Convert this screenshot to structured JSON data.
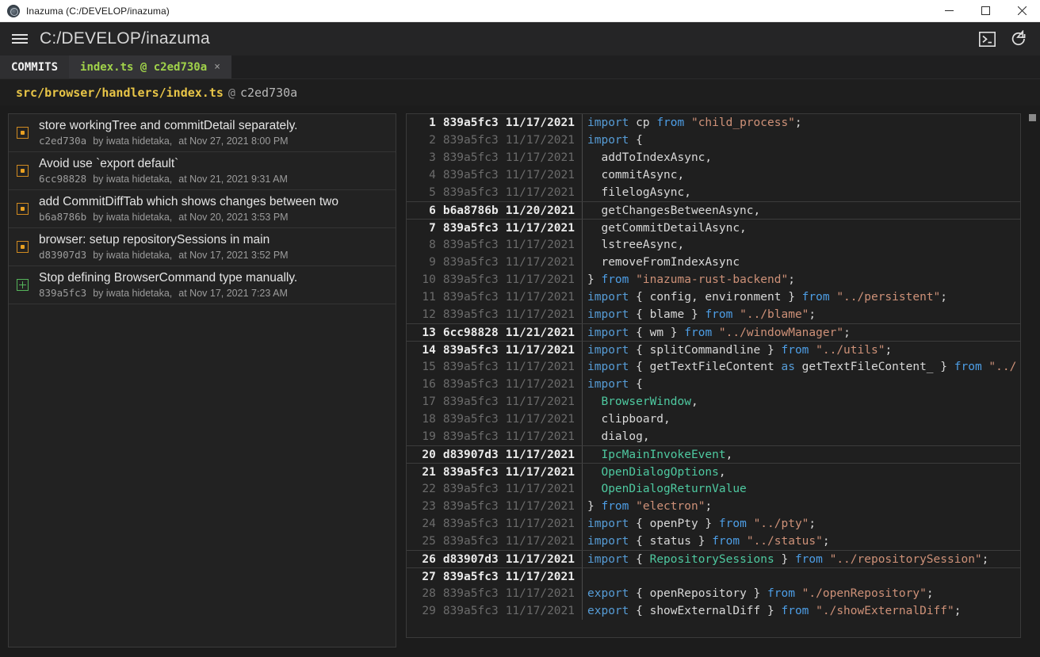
{
  "titlebar": {
    "title": "Inazuma (C:/DEVELOP/inazuma)",
    "app_icon": "app-logo-icon",
    "minimize": "minimize-icon",
    "maximize": "maximize-icon",
    "close": "close-icon"
  },
  "appbar": {
    "menu_icon": "hamburger-menu-icon",
    "repo_path": "C:/DEVELOP/inazuma",
    "terminal_icon": "terminal-icon",
    "refresh_icon": "refresh-icon"
  },
  "tabs": [
    {
      "label": "COMMITS",
      "active": false,
      "closable": false
    },
    {
      "label": "index.ts @ c2ed730a",
      "active": true,
      "closable": true,
      "close_label": "×"
    }
  ],
  "pathline": {
    "file": "src/browser/handlers/index.ts",
    "at": "@",
    "revision": "c2ed730a"
  },
  "commits": [
    {
      "summary": "store workingTree and commitDetail separately.",
      "hash": "c2ed730a",
      "author": "by iwata hidetaka,",
      "date": "at Nov 27, 2021 8:00 PM",
      "mark": "merge"
    },
    {
      "summary": "Avoid use `export default`",
      "hash": "6cc98828",
      "author": "by iwata hidetaka,",
      "date": "at Nov 21, 2021 9:31 AM",
      "mark": "merge"
    },
    {
      "summary": "add CommitDiffTab which shows changes between two",
      "hash": "b6a8786b",
      "author": "by iwata hidetaka,",
      "date": "at Nov 20, 2021 3:53 PM",
      "mark": "merge"
    },
    {
      "summary": "browser: setup repositorySessions in main",
      "hash": "d83907d3",
      "author": "by iwata hidetaka,",
      "date": "at Nov 17, 2021 3:52 PM",
      "mark": "merge"
    },
    {
      "summary": "Stop defining BrowserCommand type manually.",
      "hash": "839a5fc3",
      "author": "by iwata hidetaka,",
      "date": "at Nov 17, 2021 7:23 AM",
      "mark": "plus"
    }
  ],
  "blame_lines": [
    {
      "ln": "1",
      "hash": "839a5fc3",
      "date": "11/17/2021",
      "bright": true,
      "groupstart": true,
      "tokens": [
        {
          "t": "kw",
          "v": "import"
        },
        {
          "t": "punct",
          "v": " cp "
        },
        {
          "t": "from",
          "v": "from"
        },
        {
          "t": "punct",
          "v": " "
        },
        {
          "t": "str",
          "v": "\"child_process\""
        },
        {
          "t": "punct",
          "v": ";"
        }
      ]
    },
    {
      "ln": "2",
      "hash": "839a5fc3",
      "date": "11/17/2021",
      "bright": false,
      "groupstart": false,
      "tokens": [
        {
          "t": "kw",
          "v": "import"
        },
        {
          "t": "punct",
          "v": " {"
        }
      ]
    },
    {
      "ln": "3",
      "hash": "839a5fc3",
      "date": "11/17/2021",
      "bright": false,
      "groupstart": false,
      "tokens": [
        {
          "t": "id",
          "v": "  addToIndexAsync,"
        }
      ]
    },
    {
      "ln": "4",
      "hash": "839a5fc3",
      "date": "11/17/2021",
      "bright": false,
      "groupstart": false,
      "tokens": [
        {
          "t": "id",
          "v": "  commitAsync,"
        }
      ]
    },
    {
      "ln": "5",
      "hash": "839a5fc3",
      "date": "11/17/2021",
      "bright": false,
      "groupstart": false,
      "tokens": [
        {
          "t": "id",
          "v": "  filelogAsync,"
        }
      ]
    },
    {
      "ln": "6",
      "hash": "b6a8786b",
      "date": "11/20/2021",
      "bright": true,
      "groupstart": true,
      "tokens": [
        {
          "t": "id",
          "v": "  getChangesBetweenAsync,"
        }
      ]
    },
    {
      "ln": "7",
      "hash": "839a5fc3",
      "date": "11/17/2021",
      "bright": true,
      "groupstart": true,
      "tokens": [
        {
          "t": "id",
          "v": "  getCommitDetailAsync,"
        }
      ]
    },
    {
      "ln": "8",
      "hash": "839a5fc3",
      "date": "11/17/2021",
      "bright": false,
      "groupstart": false,
      "tokens": [
        {
          "t": "id",
          "v": "  lstreeAsync,"
        }
      ]
    },
    {
      "ln": "9",
      "hash": "839a5fc3",
      "date": "11/17/2021",
      "bright": false,
      "groupstart": false,
      "tokens": [
        {
          "t": "id",
          "v": "  removeFromIndexAsync"
        }
      ]
    },
    {
      "ln": "10",
      "hash": "839a5fc3",
      "date": "11/17/2021",
      "bright": false,
      "groupstart": false,
      "tokens": [
        {
          "t": "punct",
          "v": "} "
        },
        {
          "t": "from",
          "v": "from"
        },
        {
          "t": "punct",
          "v": " "
        },
        {
          "t": "str",
          "v": "\"inazuma-rust-backend\""
        },
        {
          "t": "punct",
          "v": ";"
        }
      ]
    },
    {
      "ln": "11",
      "hash": "839a5fc3",
      "date": "11/17/2021",
      "bright": false,
      "groupstart": false,
      "tokens": [
        {
          "t": "kw",
          "v": "import"
        },
        {
          "t": "punct",
          "v": " { "
        },
        {
          "t": "id",
          "v": "config, environment"
        },
        {
          "t": "punct",
          "v": " } "
        },
        {
          "t": "from",
          "v": "from"
        },
        {
          "t": "punct",
          "v": " "
        },
        {
          "t": "str",
          "v": "\"../persistent\""
        },
        {
          "t": "punct",
          "v": ";"
        }
      ]
    },
    {
      "ln": "12",
      "hash": "839a5fc3",
      "date": "11/17/2021",
      "bright": false,
      "groupstart": false,
      "tokens": [
        {
          "t": "kw",
          "v": "import"
        },
        {
          "t": "punct",
          "v": " { "
        },
        {
          "t": "id",
          "v": "blame"
        },
        {
          "t": "punct",
          "v": " } "
        },
        {
          "t": "from",
          "v": "from"
        },
        {
          "t": "punct",
          "v": " "
        },
        {
          "t": "str",
          "v": "\"../blame\""
        },
        {
          "t": "punct",
          "v": ";"
        }
      ]
    },
    {
      "ln": "13",
      "hash": "6cc98828",
      "date": "11/21/2021",
      "bright": true,
      "groupstart": true,
      "tokens": [
        {
          "t": "kw",
          "v": "import"
        },
        {
          "t": "punct",
          "v": " { "
        },
        {
          "t": "id",
          "v": "wm"
        },
        {
          "t": "punct",
          "v": " } "
        },
        {
          "t": "from",
          "v": "from"
        },
        {
          "t": "punct",
          "v": " "
        },
        {
          "t": "str",
          "v": "\"../windowManager\""
        },
        {
          "t": "punct",
          "v": ";"
        }
      ]
    },
    {
      "ln": "14",
      "hash": "839a5fc3",
      "date": "11/17/2021",
      "bright": true,
      "groupstart": true,
      "tokens": [
        {
          "t": "kw",
          "v": "import"
        },
        {
          "t": "punct",
          "v": " { "
        },
        {
          "t": "id",
          "v": "splitCommandline"
        },
        {
          "t": "punct",
          "v": " } "
        },
        {
          "t": "from",
          "v": "from"
        },
        {
          "t": "punct",
          "v": " "
        },
        {
          "t": "str",
          "v": "\"../utils\""
        },
        {
          "t": "punct",
          "v": ";"
        }
      ]
    },
    {
      "ln": "15",
      "hash": "839a5fc3",
      "date": "11/17/2021",
      "bright": false,
      "groupstart": false,
      "tokens": [
        {
          "t": "kw",
          "v": "import"
        },
        {
          "t": "punct",
          "v": " { "
        },
        {
          "t": "id",
          "v": "getTextFileContent "
        },
        {
          "t": "as",
          "v": "as"
        },
        {
          "t": "id",
          "v": " getTextFileContent_"
        },
        {
          "t": "punct",
          "v": " } "
        },
        {
          "t": "from",
          "v": "from"
        },
        {
          "t": "punct",
          "v": " "
        },
        {
          "t": "str",
          "v": "\"../"
        }
      ]
    },
    {
      "ln": "16",
      "hash": "839a5fc3",
      "date": "11/17/2021",
      "bright": false,
      "groupstart": false,
      "tokens": [
        {
          "t": "kw",
          "v": "import"
        },
        {
          "t": "punct",
          "v": " {"
        }
      ]
    },
    {
      "ln": "17",
      "hash": "839a5fc3",
      "date": "11/17/2021",
      "bright": false,
      "groupstart": false,
      "tokens": [
        {
          "t": "type",
          "v": "  BrowserWindow"
        },
        {
          "t": "punct",
          "v": ","
        }
      ]
    },
    {
      "ln": "18",
      "hash": "839a5fc3",
      "date": "11/17/2021",
      "bright": false,
      "groupstart": false,
      "tokens": [
        {
          "t": "id",
          "v": "  clipboard,"
        }
      ]
    },
    {
      "ln": "19",
      "hash": "839a5fc3",
      "date": "11/17/2021",
      "bright": false,
      "groupstart": false,
      "tokens": [
        {
          "t": "id",
          "v": "  dialog,"
        }
      ]
    },
    {
      "ln": "20",
      "hash": "d83907d3",
      "date": "11/17/2021",
      "bright": true,
      "groupstart": true,
      "tokens": [
        {
          "t": "type",
          "v": "  IpcMainInvokeEvent"
        },
        {
          "t": "punct",
          "v": ","
        }
      ]
    },
    {
      "ln": "21",
      "hash": "839a5fc3",
      "date": "11/17/2021",
      "bright": true,
      "groupstart": true,
      "tokens": [
        {
          "t": "type",
          "v": "  OpenDialogOptions"
        },
        {
          "t": "punct",
          "v": ","
        }
      ]
    },
    {
      "ln": "22",
      "hash": "839a5fc3",
      "date": "11/17/2021",
      "bright": false,
      "groupstart": false,
      "tokens": [
        {
          "t": "type",
          "v": "  OpenDialogReturnValue"
        }
      ]
    },
    {
      "ln": "23",
      "hash": "839a5fc3",
      "date": "11/17/2021",
      "bright": false,
      "groupstart": false,
      "tokens": [
        {
          "t": "punct",
          "v": "} "
        },
        {
          "t": "from",
          "v": "from"
        },
        {
          "t": "punct",
          "v": " "
        },
        {
          "t": "str",
          "v": "\"electron\""
        },
        {
          "t": "punct",
          "v": ";"
        }
      ]
    },
    {
      "ln": "24",
      "hash": "839a5fc3",
      "date": "11/17/2021",
      "bright": false,
      "groupstart": false,
      "tokens": [
        {
          "t": "kw",
          "v": "import"
        },
        {
          "t": "punct",
          "v": " { "
        },
        {
          "t": "id",
          "v": "openPty"
        },
        {
          "t": "punct",
          "v": " } "
        },
        {
          "t": "from",
          "v": "from"
        },
        {
          "t": "punct",
          "v": " "
        },
        {
          "t": "str",
          "v": "\"../pty\""
        },
        {
          "t": "punct",
          "v": ";"
        }
      ]
    },
    {
      "ln": "25",
      "hash": "839a5fc3",
      "date": "11/17/2021",
      "bright": false,
      "groupstart": false,
      "tokens": [
        {
          "t": "kw",
          "v": "import"
        },
        {
          "t": "punct",
          "v": " { "
        },
        {
          "t": "id",
          "v": "status"
        },
        {
          "t": "punct",
          "v": " } "
        },
        {
          "t": "from",
          "v": "from"
        },
        {
          "t": "punct",
          "v": " "
        },
        {
          "t": "str",
          "v": "\"../status\""
        },
        {
          "t": "punct",
          "v": ";"
        }
      ]
    },
    {
      "ln": "26",
      "hash": "d83907d3",
      "date": "11/17/2021",
      "bright": true,
      "groupstart": true,
      "tokens": [
        {
          "t": "kw",
          "v": "import"
        },
        {
          "t": "punct",
          "v": " { "
        },
        {
          "t": "type",
          "v": "RepositorySessions"
        },
        {
          "t": "punct",
          "v": " } "
        },
        {
          "t": "from",
          "v": "from"
        },
        {
          "t": "punct",
          "v": " "
        },
        {
          "t": "str",
          "v": "\"../repositorySession\""
        },
        {
          "t": "punct",
          "v": ";"
        }
      ]
    },
    {
      "ln": "27",
      "hash": "839a5fc3",
      "date": "11/17/2021",
      "bright": true,
      "groupstart": true,
      "tokens": []
    },
    {
      "ln": "28",
      "hash": "839a5fc3",
      "date": "11/17/2021",
      "bright": false,
      "groupstart": false,
      "tokens": [
        {
          "t": "kw",
          "v": "export"
        },
        {
          "t": "punct",
          "v": " { "
        },
        {
          "t": "id",
          "v": "openRepository"
        },
        {
          "t": "punct",
          "v": " } "
        },
        {
          "t": "from",
          "v": "from"
        },
        {
          "t": "punct",
          "v": " "
        },
        {
          "t": "str",
          "v": "\"./openRepository\""
        },
        {
          "t": "punct",
          "v": ";"
        }
      ]
    },
    {
      "ln": "29",
      "hash": "839a5fc3",
      "date": "11/17/2021",
      "bright": false,
      "groupstart": false,
      "tokens": [
        {
          "t": "kw",
          "v": "export"
        },
        {
          "t": "punct",
          "v": " { "
        },
        {
          "t": "id",
          "v": "showExternalDiff"
        },
        {
          "t": "punct",
          "v": " } "
        },
        {
          "t": "from",
          "v": "from"
        },
        {
          "t": "punct",
          "v": " "
        },
        {
          "t": "str",
          "v": "\"./showExternalDiff\""
        },
        {
          "t": "punct",
          "v": ";"
        }
      ]
    }
  ],
  "scrollbar": {
    "name": "code-vertical-scrollbar"
  },
  "colors": {
    "accent_orange": "#e8a022",
    "accent_green": "#55b45a",
    "tab_active_text": "#a0d24a",
    "path_file": "#e8c547",
    "keyword": "#569cd6",
    "string": "#ce9178",
    "type": "#4ec9a0"
  }
}
